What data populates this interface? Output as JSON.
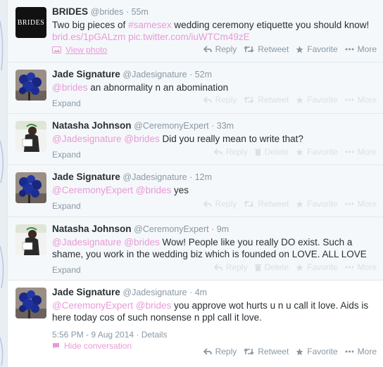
{
  "tweets": [
    {
      "name": "BRIDES",
      "handle": "@brides",
      "time": "55m",
      "text_before": "Two big pieces of ",
      "hashtag": "#samesex",
      "text_after": " wedding ceremony etiquette you should know!",
      "link1": "brid.es/1pGALzm",
      "link2": "pic.twitter.com/iuWTCm49zE",
      "view_photo": "View photo",
      "avatar_text": "BRIDES"
    },
    {
      "name": "Jade Signature",
      "handle": "@Jadesignature",
      "time": "52m",
      "mention1": "@brides",
      "text": " an abnormality n an abomination"
    },
    {
      "name": "Natasha Johnson",
      "handle": "@CeremonyExpert",
      "time": "33m",
      "mention1": "@Jadesignature",
      "mention2": "@brides",
      "text": " Did you really mean to write that?"
    },
    {
      "name": "Jade Signature",
      "handle": "@Jadesignature",
      "time": "12m",
      "mention1": "@CeremonyExpert",
      "mention2": "@brides",
      "text": " yes"
    },
    {
      "name": "Natasha Johnson",
      "handle": "@CeremonyExpert",
      "time": "9m",
      "mention1": "@Jadesignature",
      "mention2": "@brides",
      "text_line1": " Wow! People like you really DO exist. Such a",
      "text_line2": "shame, you work in the wedding biz which is founded on LOVE. ALL LOVE"
    },
    {
      "name": "Jade Signature",
      "handle": "@Jadesignature",
      "time": "4m",
      "mention1": "@CeremonyExpert",
      "mention2": "@brides",
      "text_line1": " you approve wot hurts u n u call it love. Aids is",
      "text_line2": "here today cos of such nonsense n ppl call it love.",
      "timestamp": "5:56 PM - 9 Aug 2014",
      "details": "Details",
      "hide_conversation": "Hide conversation"
    }
  ],
  "labels": {
    "reply": "Reply",
    "retweet": "Retweet",
    "delete": "Delete",
    "favorite": "Favorite",
    "more": "More",
    "expand": "Expand",
    "sep": " · ",
    "dot": "·"
  },
  "colors": {
    "link": "#e89ad7",
    "meta": "#8899a6",
    "name": "#292f33"
  }
}
